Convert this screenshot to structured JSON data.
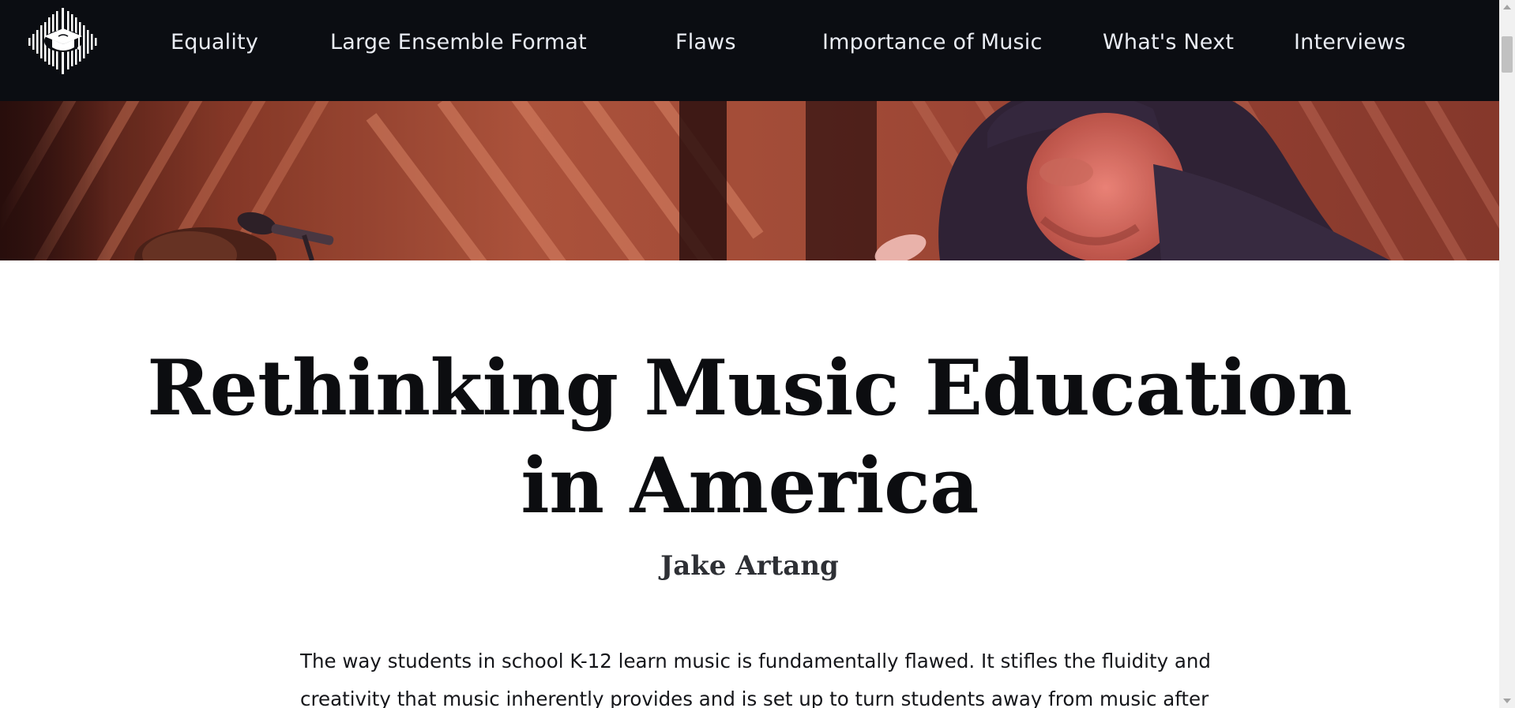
{
  "nav": {
    "items": [
      {
        "label": "Equality"
      },
      {
        "label": "Large Ensemble Format"
      },
      {
        "label": "Flaws"
      },
      {
        "label": "Importance of Music"
      },
      {
        "label": "What's Next"
      },
      {
        "label": "Interviews"
      }
    ],
    "background": "#0b0d12",
    "text_color": "#e9ecf3"
  },
  "logo": {
    "icon": "music-education-logo-icon"
  },
  "hero": {
    "description_icon": "concert-photo"
  },
  "article": {
    "title_line1": "Rethinking Music Education",
    "title_line2": "in America",
    "author": "Jake Artang",
    "intro_line1": "The way students in school K-12 learn music is fundamentally flawed. It stifles the fluidity and",
    "intro_line2": "creativity that music inherently provides and is set up to turn students away from music after"
  }
}
